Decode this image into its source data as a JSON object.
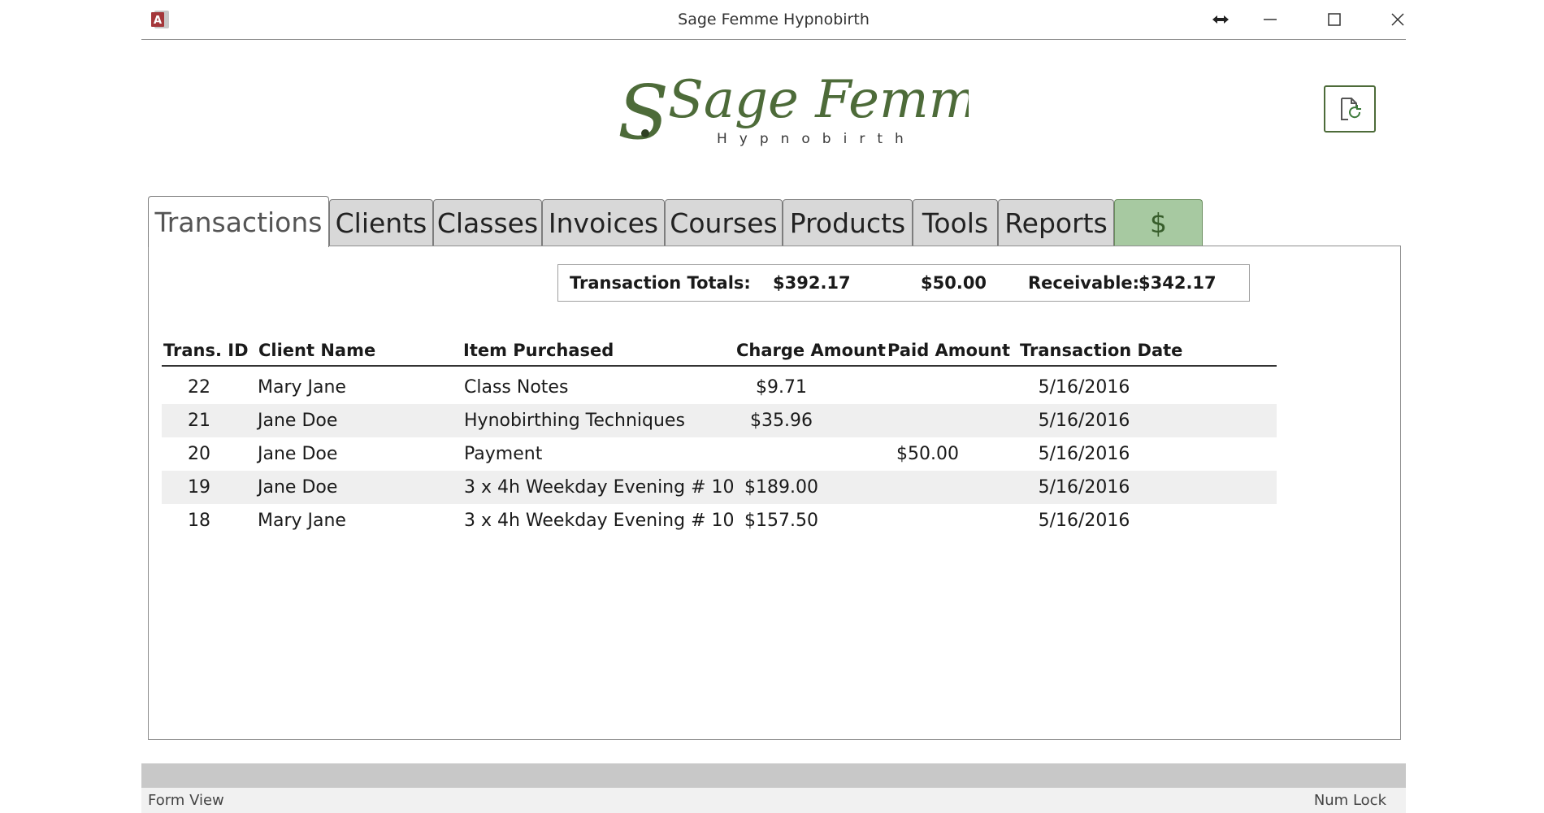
{
  "window": {
    "title": "Sage Femme Hypnobirth",
    "app_icon": "access-icon"
  },
  "logo": {
    "name": "Sage Femme",
    "tagline": "Hypnobirth"
  },
  "tabs": [
    {
      "label": "Transactions",
      "active": true
    },
    {
      "label": "Clients"
    },
    {
      "label": "Classes"
    },
    {
      "label": "Invoices"
    },
    {
      "label": "Courses"
    },
    {
      "label": "Products"
    },
    {
      "label": "Tools"
    },
    {
      "label": "Reports"
    },
    {
      "label": "$"
    }
  ],
  "totals": {
    "label": "Transaction Totals:",
    "charge_total": "$392.17",
    "paid_total": "$50.00",
    "receivable_label": "Receivable:",
    "receivable": "$342.17"
  },
  "table": {
    "headers": {
      "id": "Trans. ID",
      "client": "Client Name",
      "item": "Item Purchased",
      "charge": "Charge Amount",
      "paid": "Paid Amount",
      "date": "Transaction Date"
    },
    "rows": [
      {
        "id": "22",
        "client": "Mary Jane",
        "item": "Class Notes",
        "charge": "$9.71",
        "paid": "",
        "date": "5/16/2016"
      },
      {
        "id": "21",
        "client": "Jane Doe",
        "item": "Hynobirthing Techniques",
        "charge": "$35.96",
        "paid": "",
        "date": "5/16/2016"
      },
      {
        "id": "20",
        "client": "Jane Doe",
        "item": "Payment",
        "charge": "",
        "paid": "$50.00",
        "date": "5/16/2016"
      },
      {
        "id": "19",
        "client": "Jane Doe",
        "item": "3 x 4h Weekday Evening # 10",
        "charge": "$189.00",
        "paid": "",
        "date": "5/16/2016"
      },
      {
        "id": "18",
        "client": "Mary Jane",
        "item": "3 x 4h Weekday Evening # 10",
        "charge": "$157.50",
        "paid": "",
        "date": "5/16/2016"
      }
    ]
  },
  "status": {
    "left": "Form View",
    "right": "Num Lock"
  },
  "colors": {
    "brand_green": "#4d6b39",
    "dollar_tab": "#a7c9a1",
    "access_red": "#a4373a"
  }
}
